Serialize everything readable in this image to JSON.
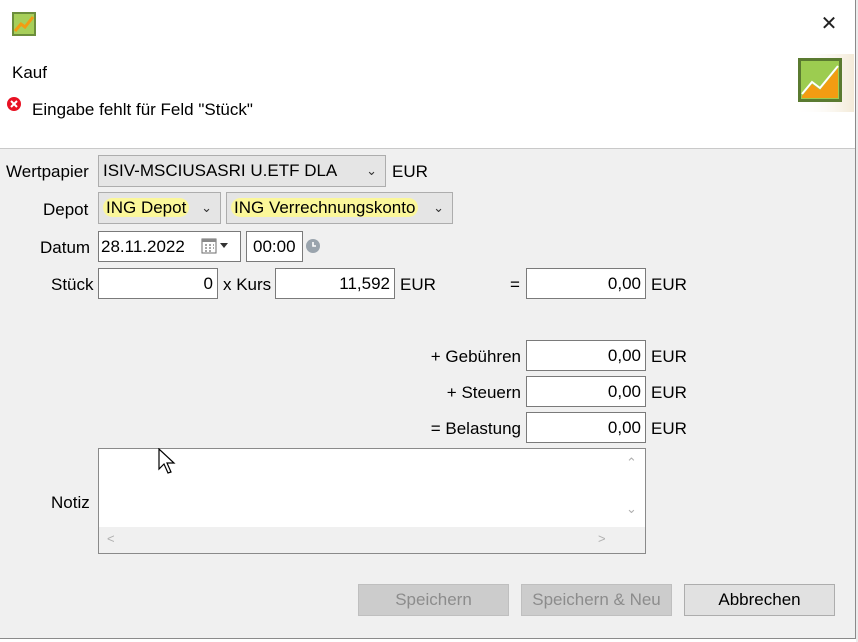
{
  "window": {
    "close_glyph": "✕",
    "app_icon": "portfolio-chart-icon"
  },
  "header": {
    "title": "Kauf",
    "error_message": "Eingabe fehlt für Feld \"Stück\"",
    "error_icon": "error-circle-icon",
    "logo_icon": "portfolio-chart-icon"
  },
  "form": {
    "security_label": "Wertpapier",
    "security_value": "ISIV-MSCIUSASRI U.ETF DLA",
    "security_currency": "EUR",
    "depot_label": "Depot",
    "depot_value": "ING Depot",
    "account_value": "ING Verrechnungskonto",
    "date_label": "Datum",
    "date_value": "28.11.2022",
    "time_value": "00:00",
    "shares_label": "Stück",
    "shares_value": "0",
    "price_label": "x Kurs",
    "price_value": "11,592",
    "price_currency": "EUR",
    "equals": "=",
    "total_value": "0,00",
    "total_currency": "EUR",
    "fees_label": "+ Gebühren",
    "fees_value": "0,00",
    "fees_currency": "EUR",
    "taxes_label": "+ Steuern",
    "taxes_value": "0,00",
    "taxes_currency": "EUR",
    "debit_label": "= Belastung",
    "debit_value": "0,00",
    "debit_currency": "EUR",
    "note_label": "Notiz",
    "note_value": ""
  },
  "buttons": {
    "save": "Speichern",
    "save_new": "Speichern & Neu",
    "cancel": "Abbrechen"
  },
  "colors": {
    "highlight": "#fbf79a",
    "error": "#e81123",
    "logo_orange": "#f39c12",
    "logo_green": "#7cb342"
  }
}
